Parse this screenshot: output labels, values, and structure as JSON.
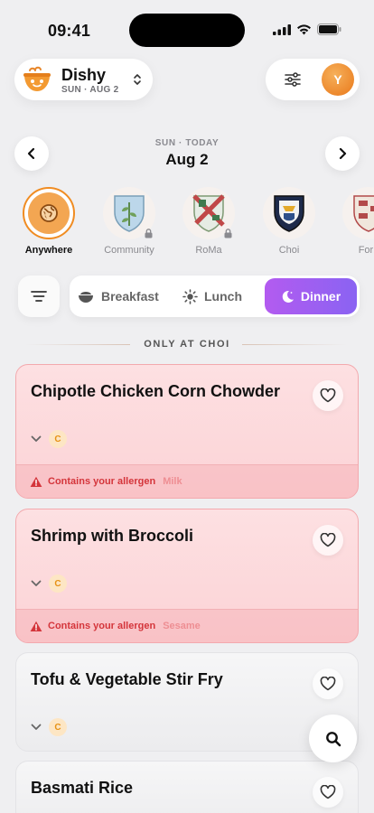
{
  "status_bar": {
    "time": "09:41"
  },
  "brand": {
    "name": "Dishy",
    "date": "SUN · AUG 2"
  },
  "profile": {
    "initial": "Y"
  },
  "date_nav": {
    "subtitle": "SUN · TODAY",
    "date": "Aug 2"
  },
  "locations": [
    {
      "label": "Anywhere",
      "active": true,
      "locked": false,
      "icon": "globe-icon"
    },
    {
      "label": "Community",
      "active": false,
      "locked": true,
      "icon": "community-crest-icon"
    },
    {
      "label": "RoMa",
      "active": false,
      "locked": true,
      "icon": "roma-crest-icon"
    },
    {
      "label": "Choi",
      "active": false,
      "locked": false,
      "icon": "choi-crest-icon"
    },
    {
      "label": "Forb",
      "active": false,
      "locked": false,
      "icon": "forbes-crest-icon"
    }
  ],
  "meals": {
    "breakfast": "Breakfast",
    "lunch": "Lunch",
    "dinner": "Dinner",
    "selected": "Dinner"
  },
  "section": {
    "title": "ONLY AT CHOI"
  },
  "dishes": [
    {
      "name": "Chipotle Chicken Corn Chowder",
      "badge": "C",
      "allergen": true,
      "allergen_text": "Contains your allergen",
      "allergen_name": "Milk"
    },
    {
      "name": "Shrimp with Broccoli",
      "badge": "C",
      "allergen": true,
      "allergen_text": "Contains your allergen",
      "allergen_name": "Sesame"
    },
    {
      "name": "Tofu & Vegetable Stir Fry",
      "badge": "C",
      "allergen": false
    },
    {
      "name": "Basmati Rice",
      "badge": "",
      "allergen": false
    }
  ],
  "colors": {
    "accent_orange": "#f08c22",
    "dinner_gradient_start": "#b35bf0",
    "dinner_gradient_end": "#8a63f2",
    "allergen_red": "#d4353b"
  }
}
